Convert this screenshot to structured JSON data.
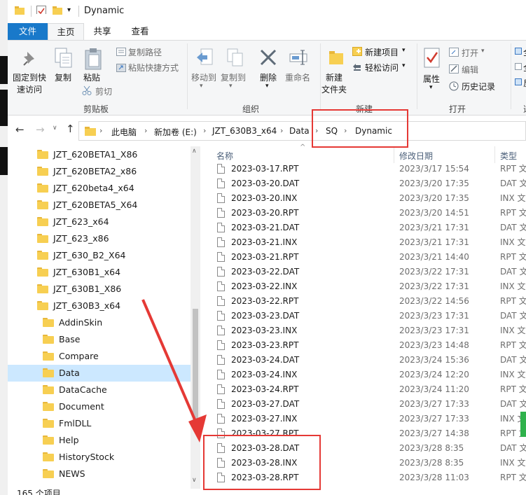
{
  "window": {
    "title": "Dynamic"
  },
  "ribbon_tabs": [
    "文件",
    "主页",
    "共享",
    "查看"
  ],
  "ribbon": {
    "clipboard": {
      "pin_label_line1": "固定到快",
      "pin_label_line2": "速访问",
      "copy_label": "复制",
      "paste_label": "粘贴",
      "copy_path_label": "复制路径",
      "paste_shortcut_label": "粘贴快捷方式",
      "cut_label": "剪切",
      "group_label": "剪贴板"
    },
    "organize": {
      "move_to_label": "移动到",
      "copy_to_label": "复制到",
      "delete_label": "删除",
      "rename_label": "重命名",
      "group_label": "组织"
    },
    "new": {
      "new_folder_line1": "新建",
      "new_folder_line2": "文件夹",
      "new_item_label": "新建项目",
      "easy_access_label": "轻松访问",
      "group_label": "新建"
    },
    "open": {
      "properties_label": "属性",
      "open_label": "打开",
      "edit_label": "编辑",
      "history_label": "历史记录",
      "group_label": "打开"
    },
    "select": {
      "item1": "全",
      "item2": "全",
      "item3": "反",
      "group_label": "选"
    }
  },
  "address": {
    "crumbs": [
      "此电脑",
      "新加卷 (E:)",
      "JZT_630B3_x64",
      "Data",
      "SQ",
      "Dynamic"
    ]
  },
  "nav_tree": [
    {
      "label": "JZT_620BETA1_X86",
      "level": 0,
      "selected": false
    },
    {
      "label": "JZT_620BETA2_x86",
      "level": 0,
      "selected": false
    },
    {
      "label": "JZT_620beta4_x64",
      "level": 0,
      "selected": false
    },
    {
      "label": "JZT_620BETA5_X64",
      "level": 0,
      "selected": false
    },
    {
      "label": "JZT_623_x64",
      "level": 0,
      "selected": false
    },
    {
      "label": "JZT_623_x86",
      "level": 0,
      "selected": false
    },
    {
      "label": "JZT_630_B2_X64",
      "level": 0,
      "selected": false
    },
    {
      "label": "JZT_630B1_x64",
      "level": 0,
      "selected": false
    },
    {
      "label": "JZT_630B1_X86",
      "level": 0,
      "selected": false
    },
    {
      "label": "JZT_630B3_x64",
      "level": 0,
      "selected": false
    },
    {
      "label": "AddinSkin",
      "level": 1,
      "selected": false
    },
    {
      "label": "Base",
      "level": 1,
      "selected": false
    },
    {
      "label": "Compare",
      "level": 1,
      "selected": false
    },
    {
      "label": "Data",
      "level": 1,
      "selected": true
    },
    {
      "label": "DataCache",
      "level": 1,
      "selected": false
    },
    {
      "label": "Document",
      "level": 1,
      "selected": false
    },
    {
      "label": "FmlDLL",
      "level": 1,
      "selected": false
    },
    {
      "label": "Help",
      "level": 1,
      "selected": false
    },
    {
      "label": "HistoryStock",
      "level": 1,
      "selected": false
    },
    {
      "label": "NEWS",
      "level": 1,
      "selected": false
    }
  ],
  "columns": {
    "name": "名称",
    "date": "修改日期",
    "type": "类型"
  },
  "files": [
    {
      "name": "2023-03-17.RPT",
      "date": "2023/3/17 15:54",
      "type": "RPT 文"
    },
    {
      "name": "2023-03-20.DAT",
      "date": "2023/3/20 17:35",
      "type": "DAT 文"
    },
    {
      "name": "2023-03-20.INX",
      "date": "2023/3/20 17:35",
      "type": "INX 文"
    },
    {
      "name": "2023-03-20.RPT",
      "date": "2023/3/20 14:51",
      "type": "RPT 文"
    },
    {
      "name": "2023-03-21.DAT",
      "date": "2023/3/21 17:31",
      "type": "DAT 文"
    },
    {
      "name": "2023-03-21.INX",
      "date": "2023/3/21 17:31",
      "type": "INX 文"
    },
    {
      "name": "2023-03-21.RPT",
      "date": "2023/3/21 14:40",
      "type": "RPT 文"
    },
    {
      "name": "2023-03-22.DAT",
      "date": "2023/3/22 17:31",
      "type": "DAT 文"
    },
    {
      "name": "2023-03-22.INX",
      "date": "2023/3/22 17:31",
      "type": "INX 文"
    },
    {
      "name": "2023-03-22.RPT",
      "date": "2023/3/22 14:56",
      "type": "RPT 文"
    },
    {
      "name": "2023-03-23.DAT",
      "date": "2023/3/23 17:31",
      "type": "DAT 文"
    },
    {
      "name": "2023-03-23.INX",
      "date": "2023/3/23 17:31",
      "type": "INX 文"
    },
    {
      "name": "2023-03-23.RPT",
      "date": "2023/3/23 14:48",
      "type": "RPT 文"
    },
    {
      "name": "2023-03-24.DAT",
      "date": "2023/3/24 15:36",
      "type": "DAT 文"
    },
    {
      "name": "2023-03-24.INX",
      "date": "2023/3/24 12:20",
      "type": "INX 文"
    },
    {
      "name": "2023-03-24.RPT",
      "date": "2023/3/24 11:20",
      "type": "RPT 文"
    },
    {
      "name": "2023-03-27.DAT",
      "date": "2023/3/27 17:33",
      "type": "DAT 文"
    },
    {
      "name": "2023-03-27.INX",
      "date": "2023/3/27 17:33",
      "type": "INX 文"
    },
    {
      "name": "2023-03-27.RPT",
      "date": "2023/3/27 14:38",
      "type": "RPT 文"
    },
    {
      "name": "2023-03-28.DAT",
      "date": "2023/3/28 8:35",
      "type": "DAT 文"
    },
    {
      "name": "2023-03-28.INX",
      "date": "2023/3/28 8:35",
      "type": "INX 文"
    },
    {
      "name": "2023-03-28.RPT",
      "date": "2023/3/28 11:03",
      "type": "RPT 文"
    }
  ],
  "status": {
    "count_text": "165 个项目"
  },
  "colors": {
    "accent": "#1979ca",
    "annotation_red": "#e53935",
    "selection": "#cce8ff"
  }
}
